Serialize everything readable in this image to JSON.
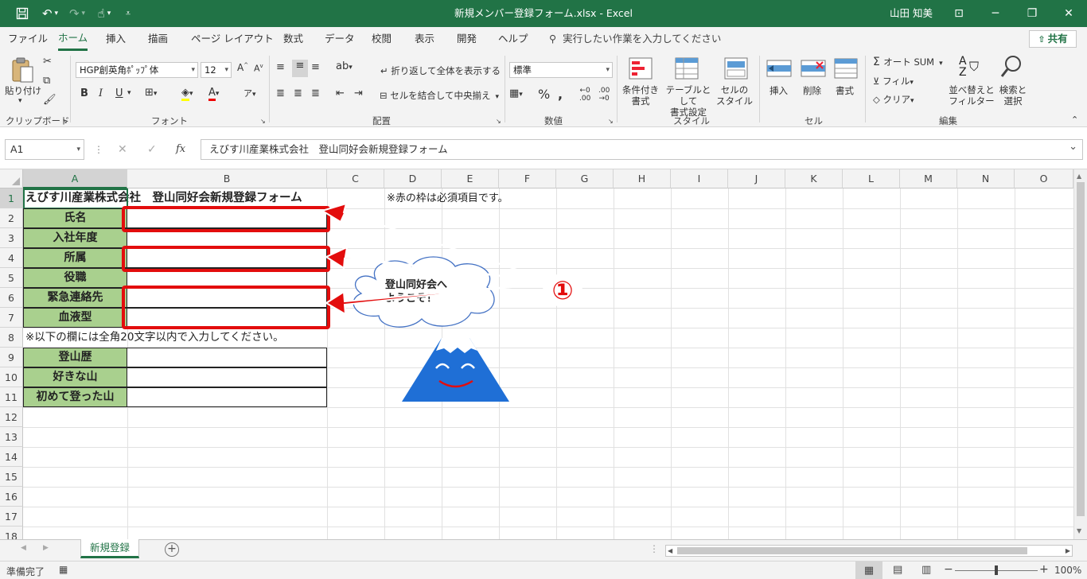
{
  "titlebar": {
    "title": "新規メンバー登録フォーム.xlsx  -  Excel",
    "user": "山田 知美",
    "minimize": "─",
    "maximize": "❐",
    "close": "✕",
    "ribbon_display": "⊡"
  },
  "menu": {
    "tabs": [
      "ファイル",
      "ホーム",
      "挿入",
      "描画",
      "ページ レイアウト",
      "数式",
      "データ",
      "校閲",
      "表示",
      "開発",
      "ヘルプ"
    ],
    "active": "ホーム",
    "tellme": "実行したい作業を入力してください",
    "share": "共有"
  },
  "ribbon": {
    "clipboard": {
      "paste": "貼り付け",
      "label": "クリップボード"
    },
    "font": {
      "name": "HGP創英角ﾎﾟｯﾌﾟ体",
      "size": "12",
      "label": "フォント",
      "bold": "B",
      "italic": "I",
      "underline": "U"
    },
    "alignment": {
      "wrap": "折り返して全体を表示する",
      "merge": "セルを結合して中央揃え",
      "label": "配置"
    },
    "number": {
      "format": "標準",
      "label": "数値"
    },
    "styles": {
      "conditional": "条件付き\n書式",
      "table": "テーブルとして\n書式設定",
      "cell": "セルの\nスタイル",
      "label": "スタイル"
    },
    "cells": {
      "insert": "挿入",
      "delete": "削除",
      "format": "書式",
      "label": "セル"
    },
    "editing": {
      "autosum": "オート SUM",
      "fill": "フィル",
      "clear": "クリア",
      "sort": "並べ替えと\nフィルター",
      "find": "検索と\n選択",
      "label": "編集"
    }
  },
  "formula": {
    "namebox": "A1",
    "content": "えびす川産業株式会社　登山同好会新規登録フォーム"
  },
  "columns": [
    "A",
    "B",
    "C",
    "D",
    "E",
    "F",
    "G",
    "H",
    "I",
    "J",
    "K",
    "L",
    "M",
    "N",
    "O"
  ],
  "rows": [
    "1",
    "2",
    "3",
    "4",
    "5",
    "6",
    "7",
    "8",
    "9",
    "10",
    "11",
    "12",
    "13",
    "14",
    "15",
    "16",
    "17",
    "18"
  ],
  "sheet": {
    "a1": "えびす川産業株式会社　登山同好会新規登録フォーム",
    "d1": "※赤の枠は必須項目です。",
    "labels": [
      "氏名",
      "入社年度",
      "所属",
      "役職",
      "緊急連絡先",
      "血液型"
    ],
    "a8": "※以下の欄には全角20文字以内で入力してください。",
    "labels2": [
      "登山歴",
      "好きな山",
      "初めて登った山"
    ]
  },
  "callout": {
    "cloud_text": "登山同好会へ\nようこそ！",
    "marker": "①"
  },
  "colors": {
    "excel_green": "#217346",
    "label_green": "#a9d08e",
    "required_red": "#e30d0d",
    "mountain_blue": "#1f6fd6"
  },
  "sheet_tab": "新規登録",
  "status": {
    "ready": "準備完了",
    "zoom": "100%"
  }
}
